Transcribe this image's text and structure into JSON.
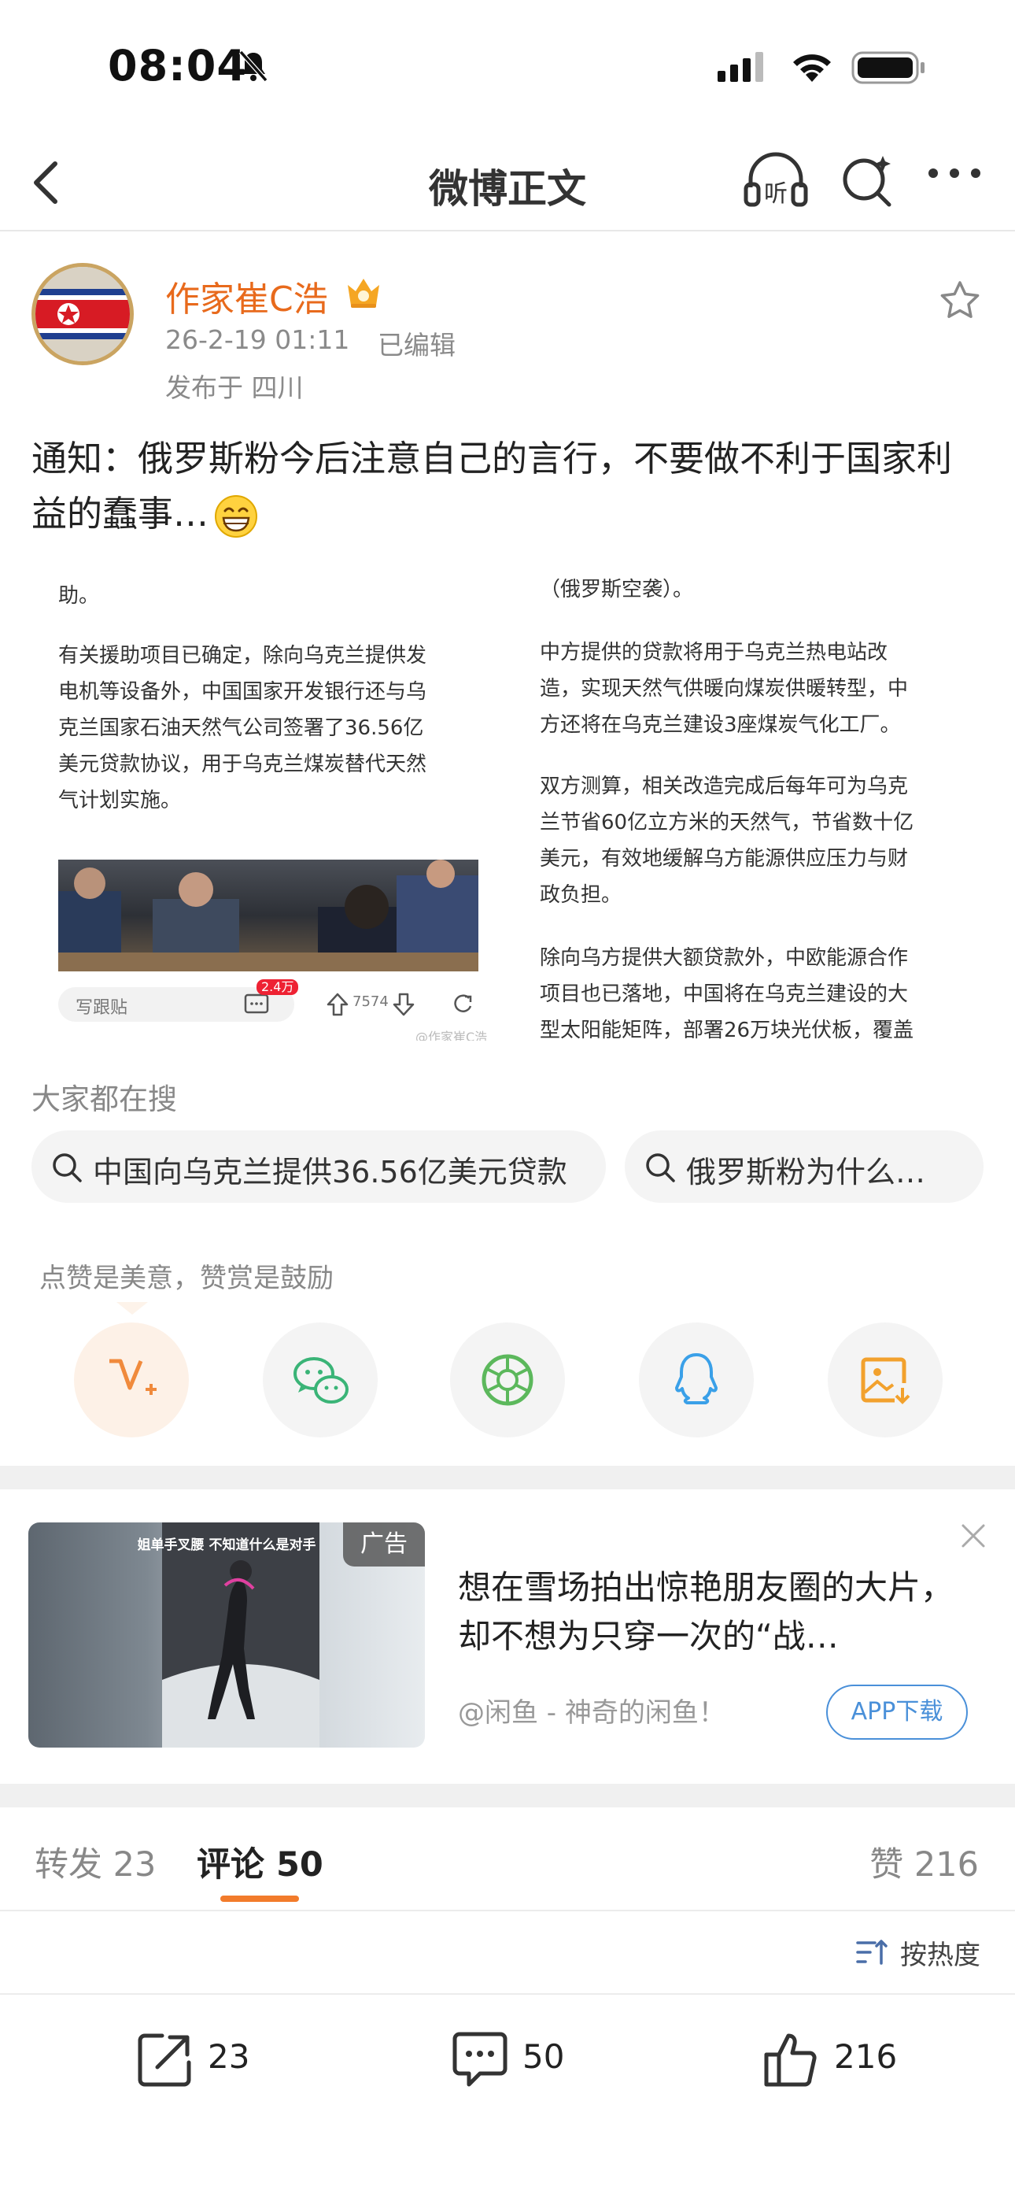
{
  "status_bar": {
    "time": "08:04"
  },
  "nav": {
    "title": "微博正文"
  },
  "post": {
    "username": "作家崔C浩",
    "time": "26-2-19 01:11",
    "edited": "已编辑",
    "location": "发布于 四川",
    "text": "通知：俄罗斯粉今后注意自己的言行，不要做不利于国家利益的蠢事…"
  },
  "news_left": {
    "line0": "助。",
    "para": [
      "有关援助项目已确定，除向乌克兰提供发",
      "电机等设备外，中国国家开发银行还与乌",
      "克兰国家石油天然气公司签署了36.56亿",
      "美元贷款协议，用于乌克兰煤炭替代天然",
      "气计划实施。"
    ],
    "comment_placeholder": "写跟贴",
    "comment_badge": "2.4万",
    "vote_count": "7574",
    "watermark": "@作家崔C浩"
  },
  "news_right": {
    "line0": "（俄罗斯空袭）。",
    "para1": [
      "中方提供的贷款将用于乌克兰热电站改",
      "造，实现天然气供暖向煤炭供暖转型，中",
      "方还将在乌克兰建设3座煤炭气化工厂。"
    ],
    "para2": [
      "双方测算，相关改造完成后每年可为乌克",
      "兰节省60亿立方米的天然气，节省数十亿",
      "美元，有效地缓解乌方能源供应压力与财",
      "政负担。"
    ],
    "para3": [
      "除向乌方提供大额贷款外，中欧能源合作",
      "项目也已落地，中国将在乌克兰建设的大",
      "型太阳能矩阵，部署26万块光伏板，覆盖"
    ]
  },
  "search": {
    "heading": "大家都在搜",
    "chips": [
      "中国向乌克兰提供36.56亿美元贷款",
      "俄罗斯粉为什么…"
    ]
  },
  "reward": {
    "text": "点赞是美意，赞赏是鼓励"
  },
  "share_icons": [
    "reward-v-icon",
    "wechat-icon",
    "moments-icon",
    "qq-icon",
    "save-image-icon"
  ],
  "ad": {
    "tag": "广告",
    "caption": "姐单手叉腰  不知道什么是对手",
    "title": "想在雪场拍出惊艳朋友圈的大片，却不想为只穿一次的“战…",
    "source": "@闲鱼 - 神奇的闲鱼！",
    "button": "APP下载"
  },
  "tabs": {
    "repost": "转发 23",
    "comment": "评论 50",
    "like": "赞 216"
  },
  "sort": {
    "label": "按热度"
  },
  "toolbar": {
    "repost": "23",
    "comment": "50",
    "like": "216"
  },
  "colors": {
    "accent": "#f27b2b",
    "username": "#e86a1c",
    "link_blue": "#4a90d9"
  }
}
